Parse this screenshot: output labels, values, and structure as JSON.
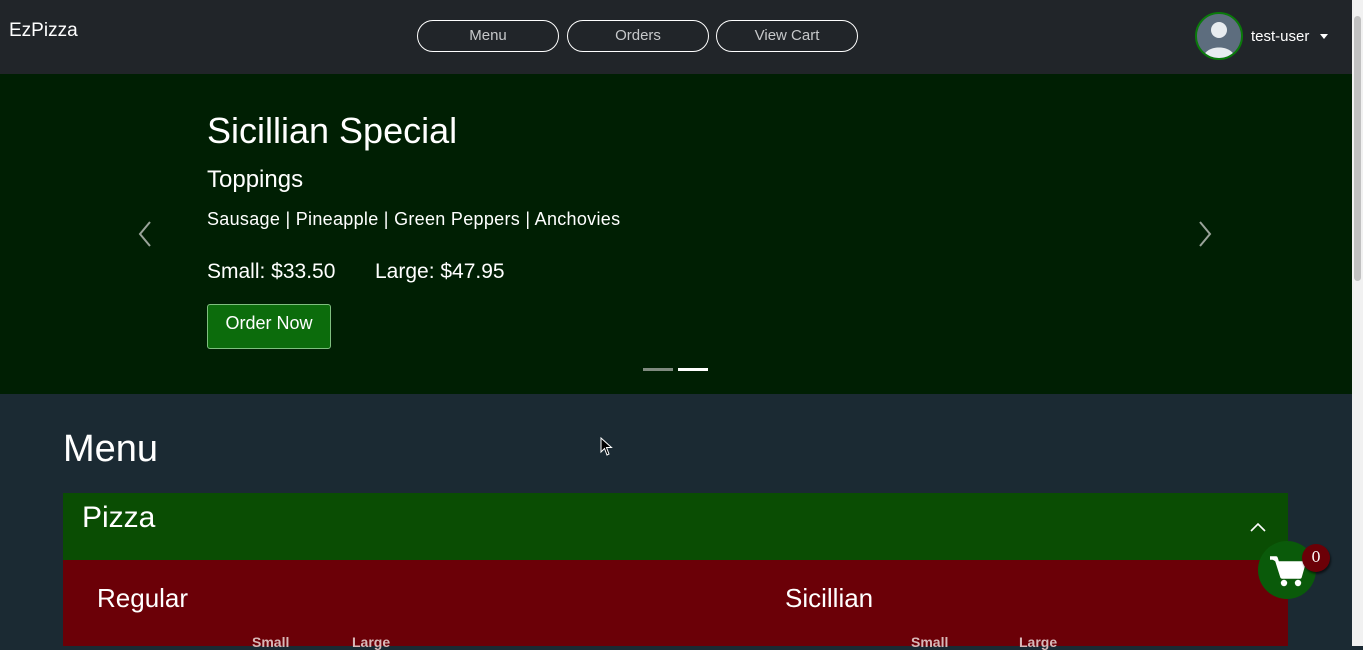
{
  "navbar": {
    "brand": "EzPizza",
    "links": [
      "Menu",
      "Orders",
      "View Cart"
    ],
    "user": "test-user"
  },
  "carousel": {
    "title": "Sicillian Special",
    "subtitle": "Toppings",
    "toppings": "Sausage | Pineapple | Green Peppers | Anchovies",
    "small_price": "Small: $33.50",
    "large_price": "Large: $47.95",
    "order_button": "Order Now",
    "slide_count": 2,
    "active_slide": 2
  },
  "menu": {
    "title": "Menu",
    "category": "Pizza",
    "columns": [
      {
        "name": "Regular",
        "sizes": [
          "Small",
          "Large"
        ]
      },
      {
        "name": "Sicillian",
        "sizes": [
          "Small",
          "Large"
        ]
      }
    ]
  },
  "cart": {
    "count": "0"
  },
  "colors": {
    "navbar": "#212529",
    "hero": "#001f03",
    "page": "#1b2a33",
    "category_header": "#0a4d03",
    "category_body": "#6b0007",
    "order_button": "#0c6c0c"
  }
}
